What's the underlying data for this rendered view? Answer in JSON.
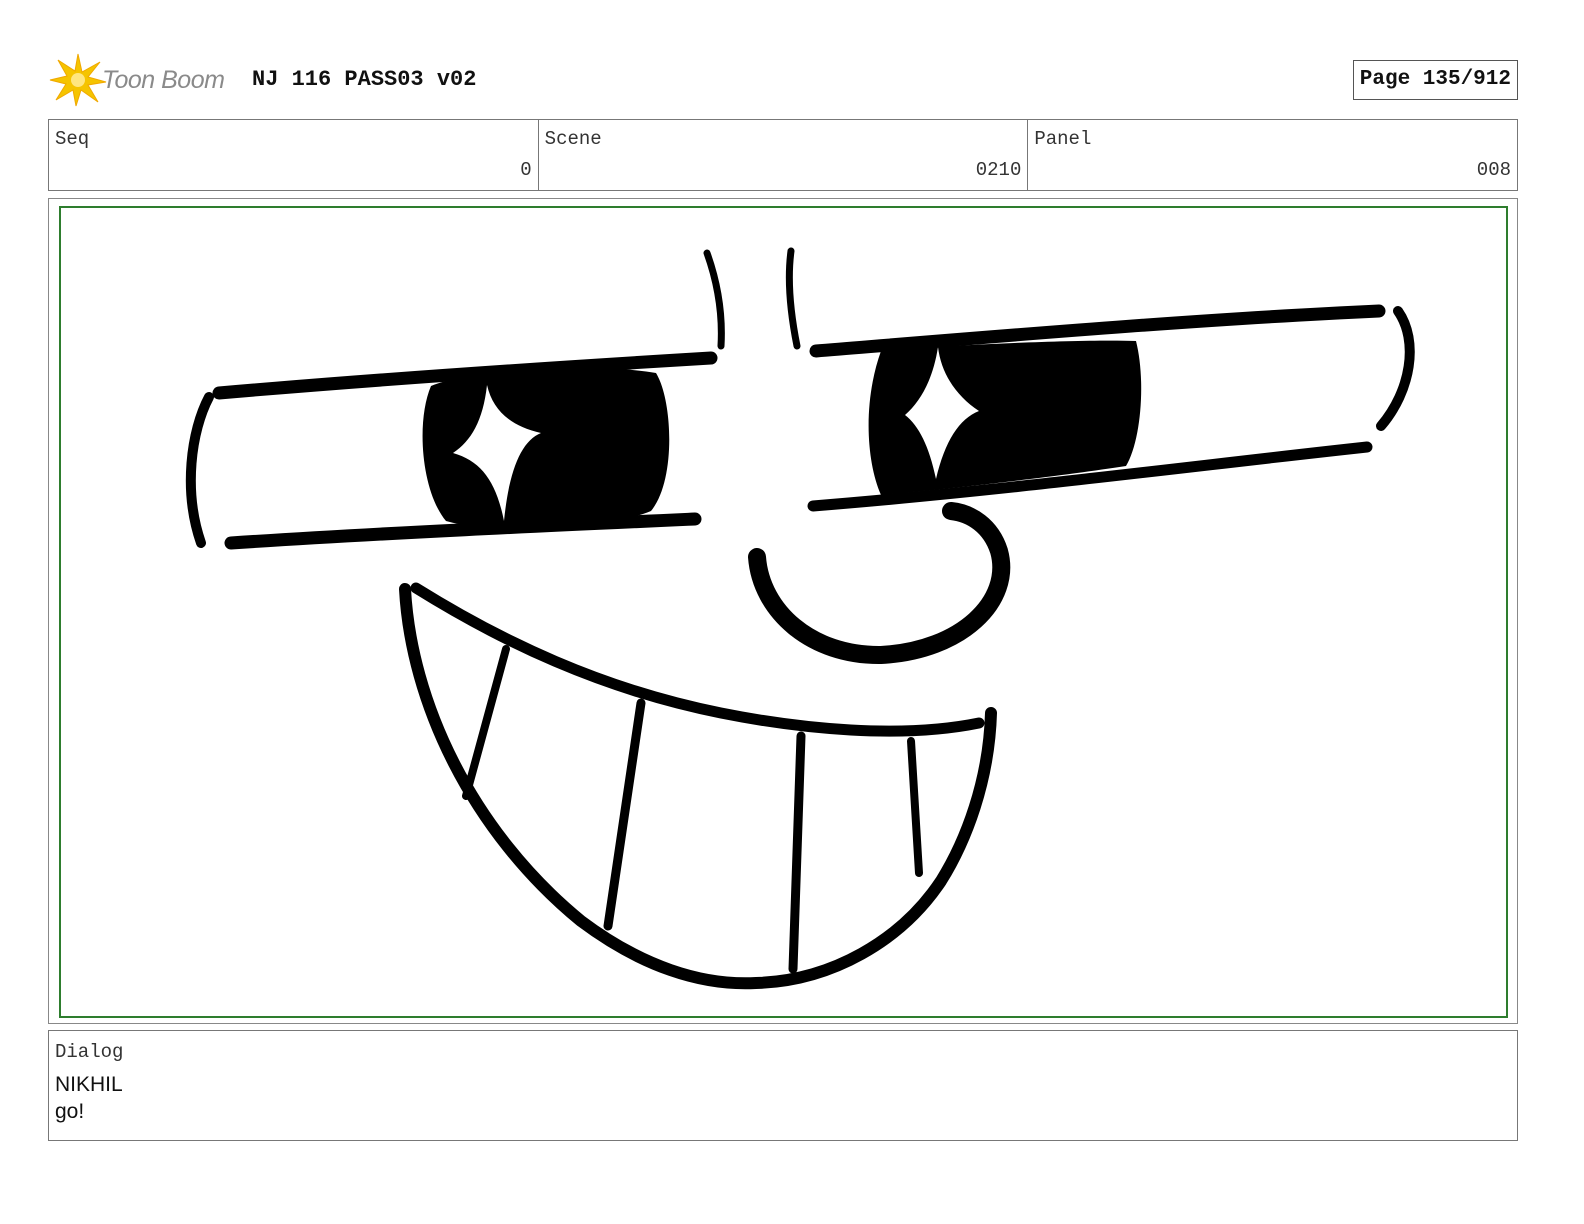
{
  "header": {
    "logo_text": "Toon Boom",
    "doc_title": "NJ 116 PASS03 v02",
    "page_label": "Page 135/912"
  },
  "info": {
    "seq_label": "Seq",
    "seq_value": "0",
    "scene_label": "Scene",
    "scene_value": "0210",
    "panel_label": "Panel",
    "panel_value": "008"
  },
  "panel": {
    "drawing": "face-sketch",
    "safe_area_color": "#2e7d2e"
  },
  "dialog": {
    "label": "Dialog",
    "speaker": "NIKHIL",
    "line": "go!"
  },
  "colors": {
    "logo_star": "#f5c400",
    "logo_text": "#8a8a8a",
    "ink": "#000000"
  }
}
